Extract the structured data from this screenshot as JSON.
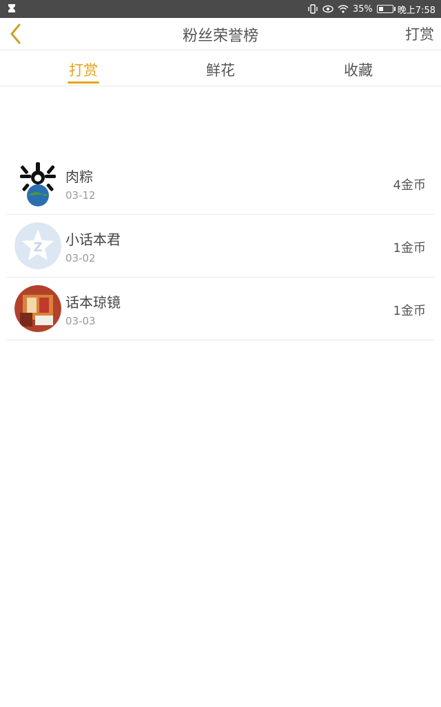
{
  "status_bar": {
    "battery": "35%",
    "time": "晚上7:58"
  },
  "navbar": {
    "title": "粉丝荣誉榜",
    "action_label": "打赏"
  },
  "tabs": [
    {
      "label": "打赏",
      "active": true
    },
    {
      "label": "鲜花",
      "active": false
    },
    {
      "label": "收藏",
      "active": false
    }
  ],
  "rows": [
    {
      "name": "肉粽",
      "date": "03-12",
      "coins": "4金币"
    },
    {
      "name": "小话本君",
      "date": "03-02",
      "coins": "1金币"
    },
    {
      "name": "话本琼镜",
      "date": "03-03",
      "coins": "1金币"
    }
  ],
  "accent_color": "#e9a21c"
}
